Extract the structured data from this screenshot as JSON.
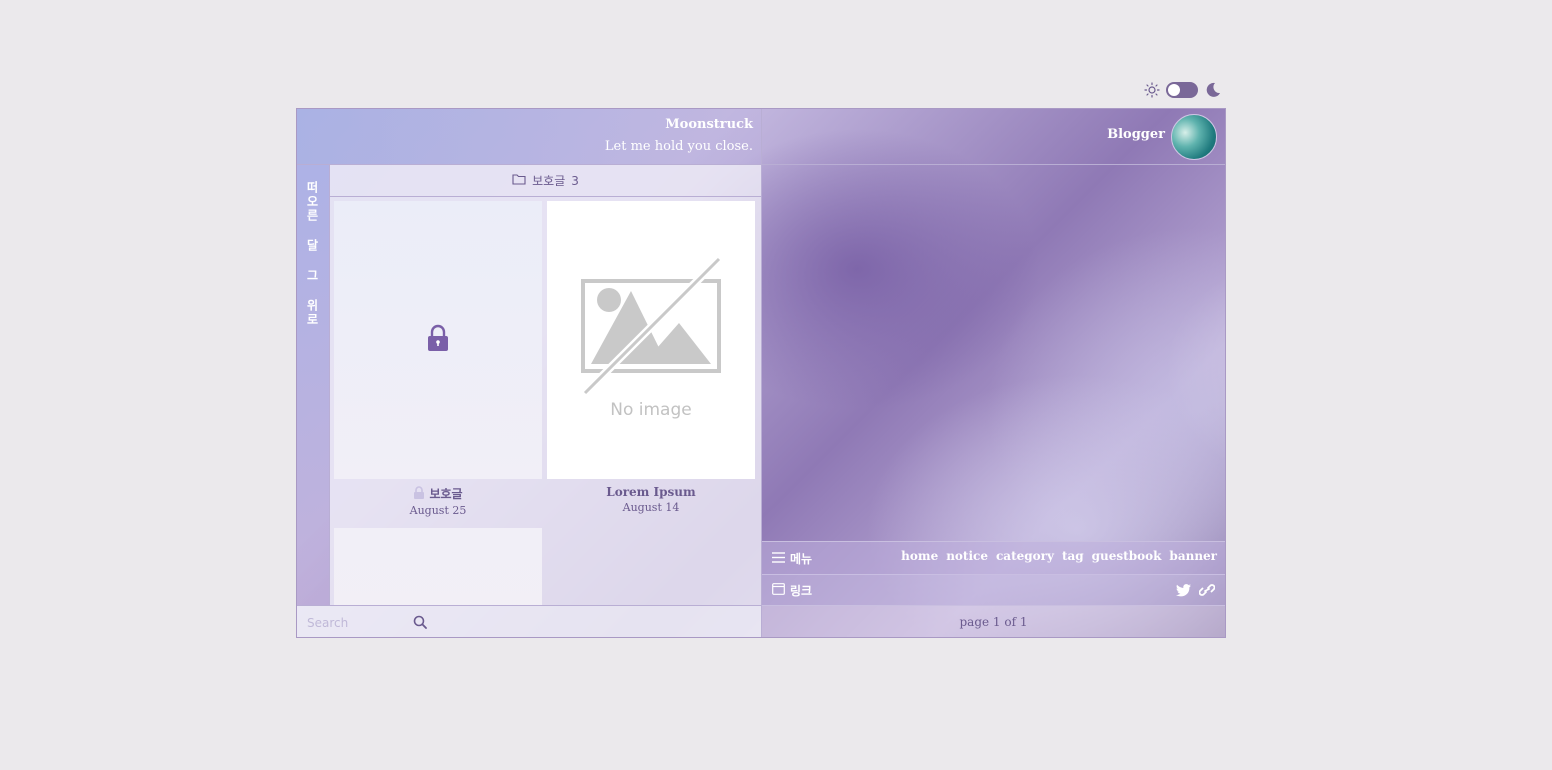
{
  "header": {
    "site_title": "Moonstruck",
    "site_description": "Let me hold you close.",
    "blogger_name": "Blogger"
  },
  "sidebar": {
    "vertical_text": "떠오른 달 그 위로"
  },
  "category": {
    "name": "보호글",
    "count": "3"
  },
  "posts": [
    {
      "title": "보호글",
      "date": "August 25",
      "locked": true
    },
    {
      "title": "Lorem Ipsum",
      "date": "August 14",
      "thumbnail": "No image"
    },
    {
      "title": "",
      "date": ""
    }
  ],
  "search": {
    "placeholder": "Search",
    "value": ""
  },
  "menu": {
    "label": "메뉴",
    "items": [
      "home",
      "notice",
      "category",
      "tag",
      "guestbook",
      "banner"
    ]
  },
  "links": {
    "label": "링크",
    "icons": [
      "twitter-icon",
      "link-icon"
    ]
  },
  "pagination": {
    "text": "page 1 of 1"
  },
  "colors": {
    "accent": "#7a6898",
    "page_bg": "#ebe9ec"
  }
}
